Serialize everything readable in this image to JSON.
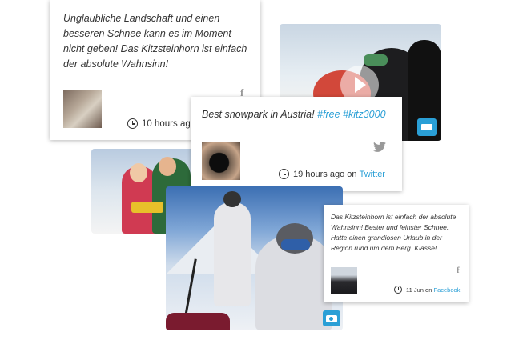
{
  "card1": {
    "quote": "Unglaubliche Landschaft und einen besseren Schnee kann es im Moment nicht geben! Das Kitzsteinhorn ist einfach der absolute Wahnsinn!",
    "time": "10 hours ago",
    "network_icon": "facebook-icon"
  },
  "card2": {
    "quote_prefix": "Best snowpark in Austria! ",
    "tags": "#free #kitz3000",
    "time": "19 hours ago",
    "on_text": " on ",
    "source": "Twitter",
    "network_icon": "twitter-icon"
  },
  "card3": {
    "quote": "Das Kitzsteinhorn ist einfach der absolute Wahnsinn! Bester und feinster Schnee. Hatte einen grandiosen Urlaub in der Region rund um dem Berg. Klasse!",
    "time": "11 Jun",
    "on_text": " on ",
    "source": "Facebook",
    "network_icon": "facebook-icon"
  },
  "photos": {
    "snowboarders": {
      "badge_icon": "video-icon"
    },
    "skiers": {
      "badge_icon": "camera-icon"
    }
  },
  "colors": {
    "accent": "#2a9fd6",
    "text": "#333333"
  }
}
